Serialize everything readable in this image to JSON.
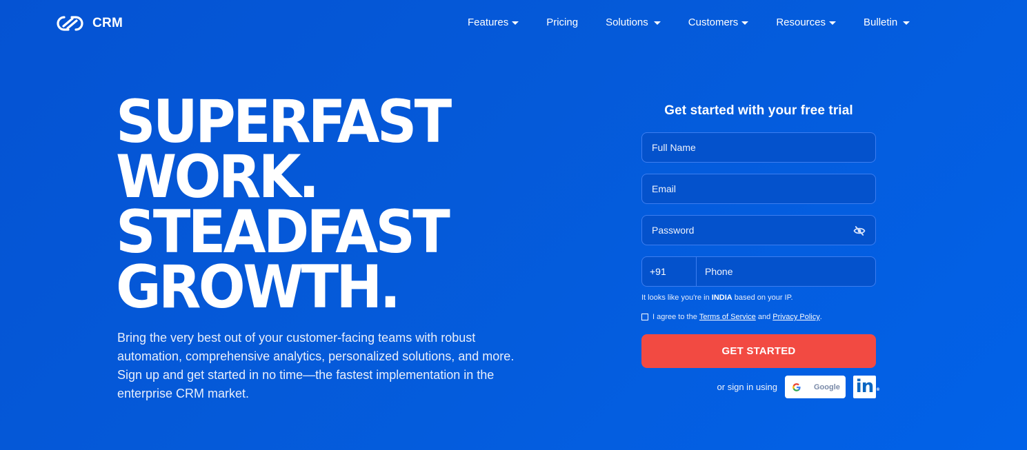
{
  "header": {
    "logo_text": "CRM",
    "nav": [
      {
        "label": "Features",
        "dropdown": true
      },
      {
        "label": "Pricing",
        "dropdown": false
      },
      {
        "label": "Solutions",
        "dropdown": true
      },
      {
        "label": "Customers",
        "dropdown": true
      },
      {
        "label": "Resources",
        "dropdown": true
      },
      {
        "label": "Bulletin",
        "dropdown": true
      }
    ]
  },
  "hero": {
    "title_lines": [
      "SUPERFAST",
      "WORK.",
      "STEADFAST",
      "GROWTH."
    ],
    "description": "Bring the very best out of your customer-facing teams with robust automation, comprehensive analytics, personalized solutions, and more. Sign up and get started in no time—the fastest implementation in the enterprise CRM market."
  },
  "signup_form": {
    "title": "Get started with your free trial",
    "full_name": {
      "placeholder": "Full Name",
      "value": ""
    },
    "email": {
      "placeholder": "Email",
      "value": ""
    },
    "password": {
      "placeholder": "Password",
      "value": "",
      "toggle_icon": "eye-hidden-icon"
    },
    "phone": {
      "country_code": "+91",
      "placeholder": "Phone",
      "value": ""
    },
    "ip_note": {
      "prefix": "It looks like you're in ",
      "country": "INDIA",
      "suffix": " based on your IP."
    },
    "agree": {
      "prefix": "I agree to the ",
      "terms": "Terms of Service",
      "and": " and ",
      "privacy": "Privacy Policy",
      "suffix": ".",
      "checked": false
    },
    "submit_label": "GET STARTED",
    "social_label": "or sign in using",
    "google_label": "Google",
    "linkedin_label": "in",
    "linkedin_reg": "®"
  },
  "colors": {
    "background": "#0559dc",
    "cta": "#f24a42",
    "field_bg": "#0452cc",
    "field_border": "#3d7ef0",
    "linkedin": "#0a66c2"
  }
}
